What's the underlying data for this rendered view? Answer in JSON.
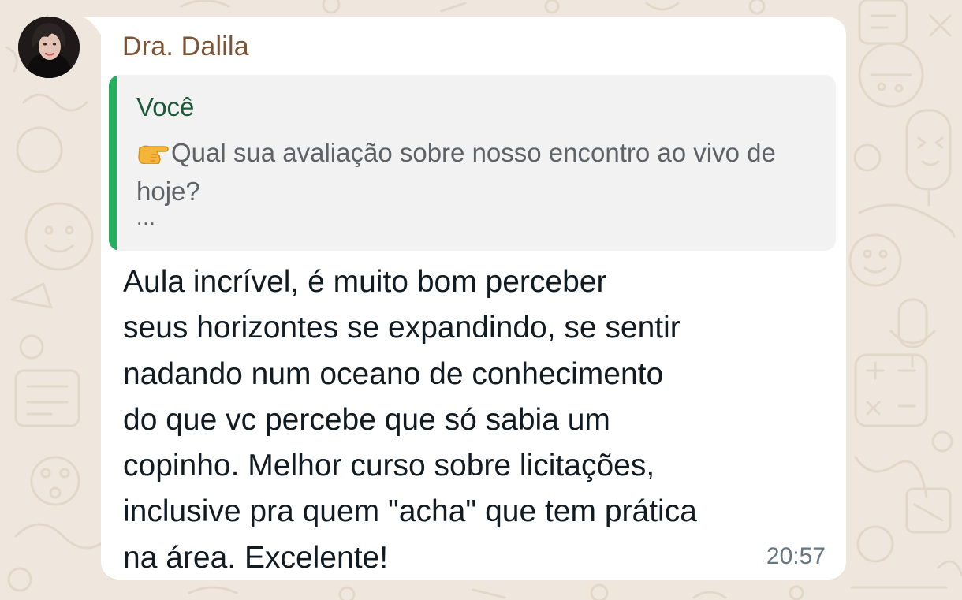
{
  "chat": {
    "sender_name": "Dra. Dalila",
    "sender_avatar": "profile-photo",
    "quoted": {
      "author": "Você",
      "emoji": "backhand-index-pointing-right",
      "text": "Qual sua avaliação sobre nosso encontro ao vivo de hoje?",
      "ellipsis": "..."
    },
    "message": "Aula incrível, é muito bom perceber\nseus horizontes se expandindo, se sentir\nnadando num oceano de conhecimento\ndo que vc percebe que só sabia um\ncopinho. Melhor curso sobre licitações,\ninclusive pra quem \"acha\" que tem prática\nna área. Excelente!",
    "time": "20:57"
  },
  "colors": {
    "wallpaper": "#efe7dd",
    "bubble": "#ffffff",
    "sender_name": "#7c5436",
    "quote_bar": "#25b05f",
    "quote_author": "#1e5b3c",
    "quote_bg": "#f3f2f2"
  }
}
